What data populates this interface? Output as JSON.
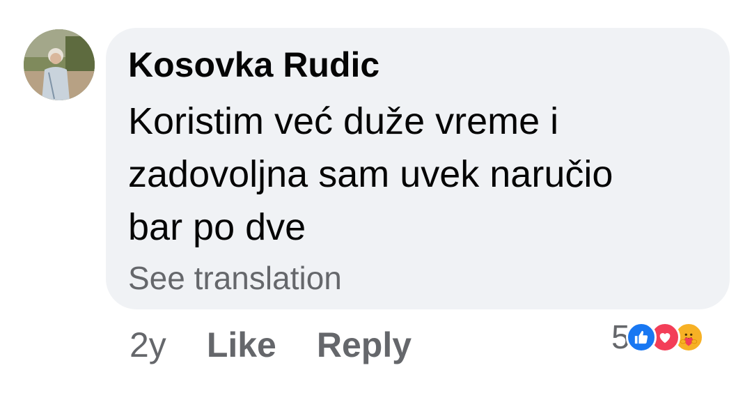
{
  "comment": {
    "author": "Kosovka Rudic",
    "lines": [
      "Koristim već duže vreme i",
      "zadovoljna sam uvek naručio",
      "bar po dve"
    ],
    "see_translation": "See translation"
  },
  "meta": {
    "time": "2y",
    "like_label": "Like",
    "reply_label": "Reply"
  },
  "reactions": {
    "count": "5",
    "icons": [
      "like-icon",
      "love-icon",
      "care-icon"
    ]
  },
  "colors": {
    "bubble": "#f0f2f5",
    "text": "#050505",
    "secondary": "#65676b",
    "like": "#1877f2",
    "love": "#f33e58",
    "care": "#f7b125"
  }
}
